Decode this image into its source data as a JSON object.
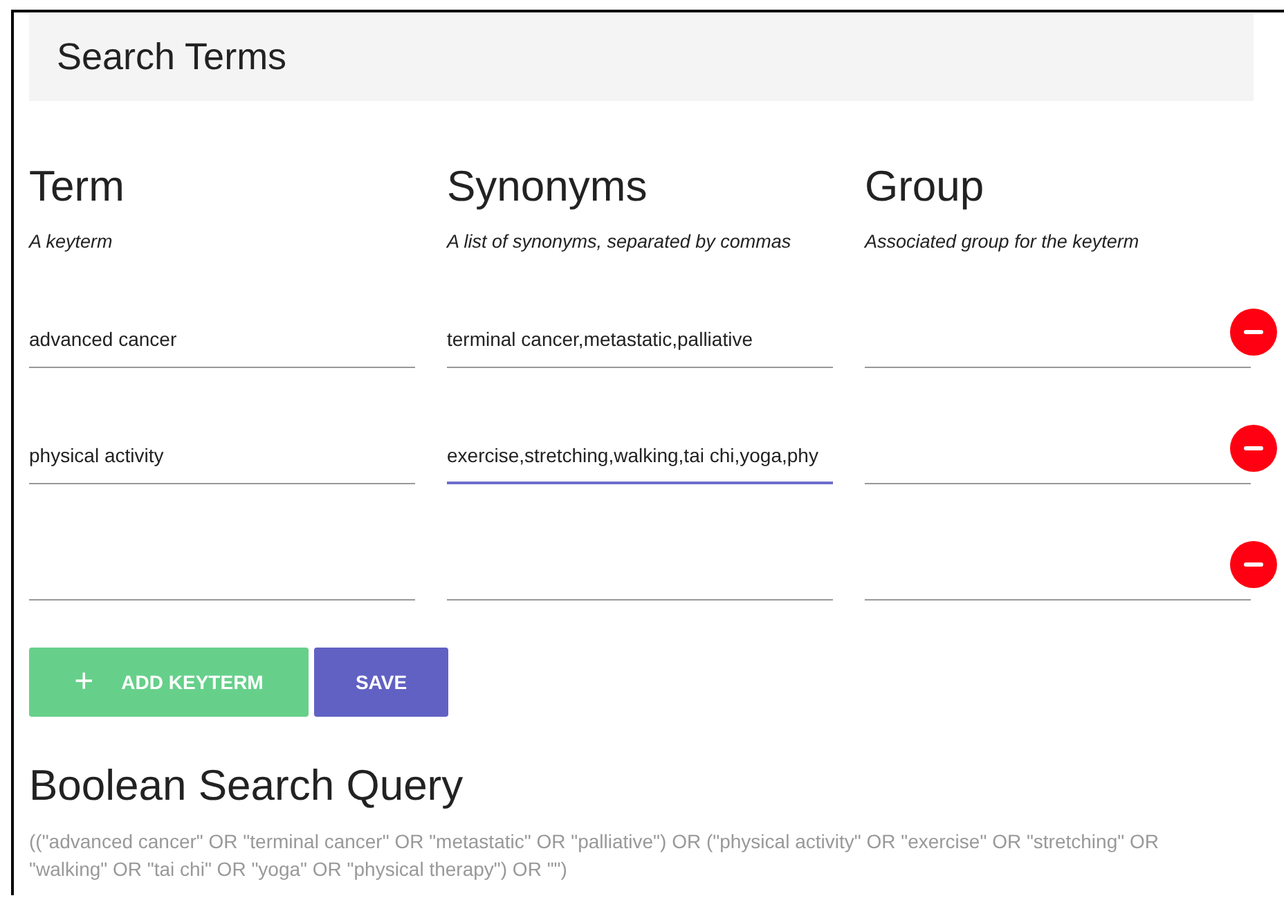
{
  "header": {
    "title": "Search Terms"
  },
  "columns": [
    {
      "heading": "Term",
      "hint": "A keyterm"
    },
    {
      "heading": "Synonyms",
      "hint": "A list of synonyms, separated by commas"
    },
    {
      "heading": "Group",
      "hint": "Associated group for the keyterm"
    }
  ],
  "rows": [
    {
      "term": {
        "value": "advanced cancer",
        "focused": false
      },
      "synonyms": {
        "value": "terminal cancer,metastatic,palliative",
        "focused": false
      },
      "group": {
        "focused": false
      }
    },
    {
      "term": {
        "value": "physical activity",
        "focused": false
      },
      "synonyms": {
        "value": "exercise,stretching,walking,tai chi,yoga,phy",
        "focused": true
      },
      "group": {
        "focused": false
      }
    },
    {
      "term": {
        "focused": false
      },
      "synonyms": {
        "focused": false
      },
      "group": {
        "focused": false
      }
    }
  ],
  "buttons": [
    {
      "kind": "add",
      "label": "ADD KEYTERM",
      "icon": "+"
    },
    {
      "kind": "save",
      "label": "SAVE"
    }
  ],
  "query": {
    "heading": "Boolean Search Query",
    "text": "((\"advanced cancer\" OR \"terminal cancer\" OR \"metastatic\" OR \"palliative\") OR (\"physical activity\" OR \"exercise\" OR \"stretching\" OR \"walking\" OR \"tai chi\" OR \"yoga\" OR \"physical therapy\") OR \"\")"
  }
}
